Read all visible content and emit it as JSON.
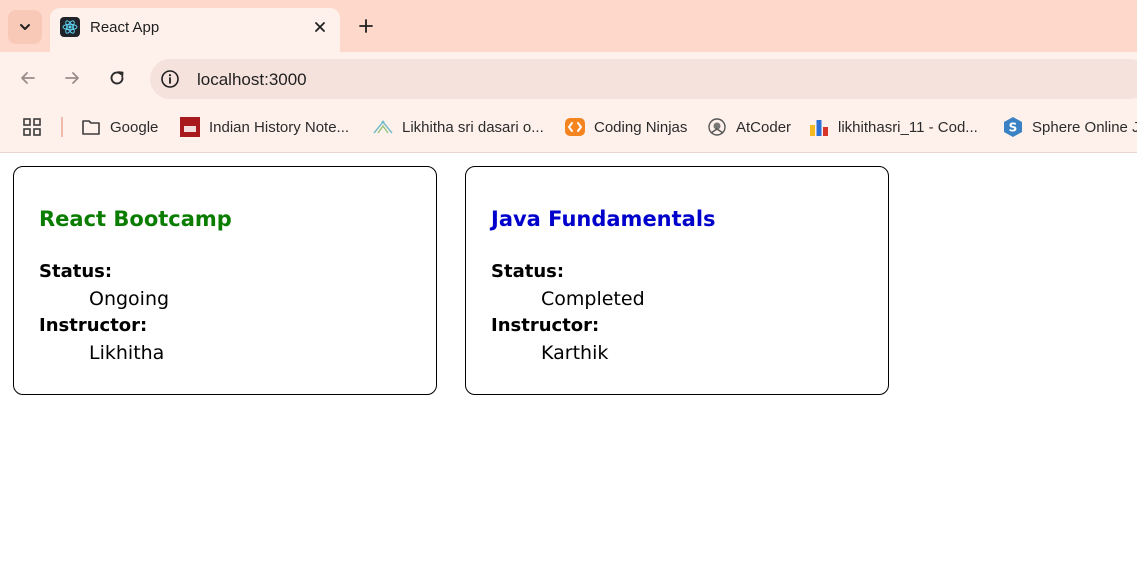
{
  "browser": {
    "tab": {
      "title": "React App"
    },
    "address": {
      "url": "localhost:3000"
    },
    "bookmarks": [
      {
        "label": "Google",
        "icon": "folder-icon"
      },
      {
        "label": "Indian History Note...",
        "icon": "clear-ias-icon"
      },
      {
        "label": "Likhitha sri dasari o...",
        "icon": "site-icon"
      },
      {
        "label": "Coding Ninjas",
        "icon": "coding-ninjas-icon"
      },
      {
        "label": "AtCoder",
        "icon": "atcoder-icon"
      },
      {
        "label": "likhithasri_11 - Cod...",
        "icon": "bar-chart-icon"
      },
      {
        "label": "Sphere Online Ju",
        "icon": "spoj-icon"
      }
    ]
  },
  "cards": [
    {
      "title": "React Bootcamp",
      "status_label": "Status:",
      "status": "Ongoing",
      "instructor_label": "Instructor:",
      "instructor": "Likhitha",
      "title_color": "#0a7d00"
    },
    {
      "title": "Java Fundamentals",
      "status_label": "Status:",
      "status": "Completed",
      "instructor_label": "Instructor:",
      "instructor": "Karthik",
      "title_color": "#0000cc"
    }
  ]
}
